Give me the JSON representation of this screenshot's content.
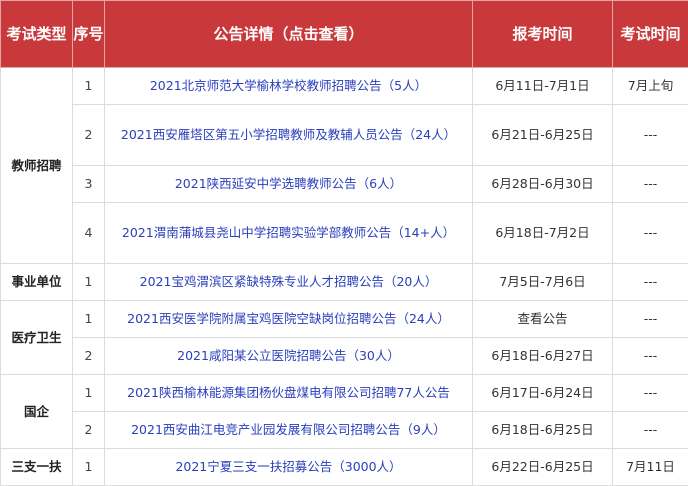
{
  "header": {
    "type": "考试类型",
    "idx": "序号",
    "detail": "公告详情（点击查看）",
    "time": "报考时间",
    "exam": "考试时间"
  },
  "groups": [
    {
      "type": "教师招聘",
      "rows": [
        {
          "idx": "1",
          "detail": "2021北京师范大学榆林学校教师招聘公告（5人）",
          "time": "6月11日-7月1日",
          "exam": "7月上旬"
        },
        {
          "idx": "2",
          "detail": "2021西安雁塔区第五小学招聘教师及教辅人员公告（24人）",
          "time": "6月21日-6月25日",
          "exam": "---"
        },
        {
          "idx": "3",
          "detail": "2021陕西延安中学选聘教师公告（6人）",
          "time": "6月28日-6月30日",
          "exam": "---"
        },
        {
          "idx": "4",
          "detail": "2021渭南蒲城县尧山中学招聘实验学部教师公告（14+人）",
          "time": "6月18日-7月2日",
          "exam": "---"
        }
      ]
    },
    {
      "type": "事业单位",
      "rows": [
        {
          "idx": "1",
          "detail": "2021宝鸡渭滨区紧缺特殊专业人才招聘公告（20人）",
          "time": "7月5日-7月6日",
          "exam": "---"
        }
      ]
    },
    {
      "type": "医疗卫生",
      "rows": [
        {
          "idx": "1",
          "detail": "2021西安医学院附属宝鸡医院空缺岗位招聘公告（24人）",
          "time": "查看公告",
          "exam": "---"
        },
        {
          "idx": "2",
          "detail": "2021咸阳某公立医院招聘公告（30人）",
          "time": "6月18日-6月27日",
          "exam": "---"
        }
      ]
    },
    {
      "type": "国企",
      "rows": [
        {
          "idx": "1",
          "detail": "2021陕西榆林能源集团杨伙盘煤电有限公司招聘77人公告",
          "time": "6月17日-6月24日",
          "exam": "---"
        },
        {
          "idx": "2",
          "detail": "2021西安曲江电竞产业园发展有限公司招聘公告（9人）",
          "time": "6月18日-6月25日",
          "exam": "---"
        }
      ]
    },
    {
      "type": "三支一扶",
      "rows": [
        {
          "idx": "1",
          "detail": "2021宁夏三支一扶招募公告（3000人）",
          "time": "6月22日-6月25日",
          "exam": "7月11日"
        }
      ]
    }
  ]
}
